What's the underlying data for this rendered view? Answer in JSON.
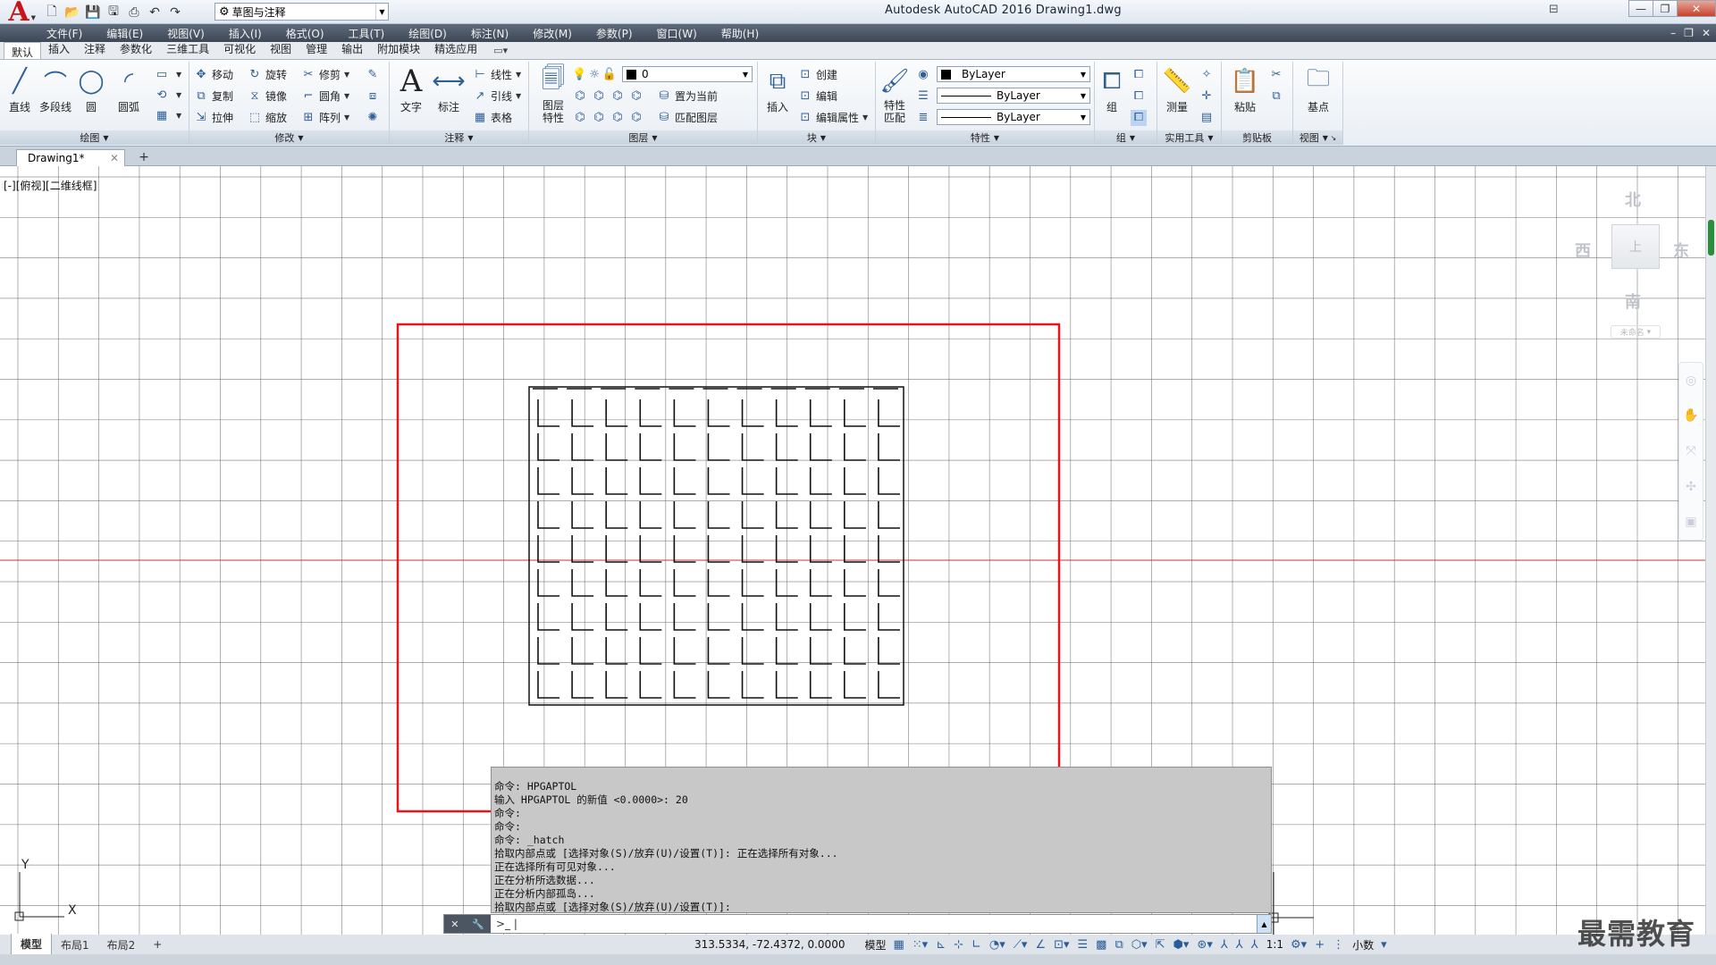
{
  "app": {
    "title": "Autodesk AutoCAD 2016    Drawing1.dwg",
    "workspace": "草图与注释",
    "logo_letter": "A"
  },
  "menu": [
    "文件(F)",
    "编辑(E)",
    "视图(V)",
    "插入(I)",
    "格式(O)",
    "工具(T)",
    "绘图(D)",
    "标注(N)",
    "修改(M)",
    "参数(P)",
    "窗口(W)",
    "帮助(H)"
  ],
  "ribbon_tabs": [
    "默认",
    "插入",
    "注释",
    "参数化",
    "三维工具",
    "可视化",
    "视图",
    "管理",
    "输出",
    "附加模块",
    "精选应用"
  ],
  "ribbon": {
    "draw": {
      "title": "绘图",
      "line": "直线",
      "polyline": "多段线",
      "circle": "圆",
      "arc": "圆弧"
    },
    "modify": {
      "title": "修改",
      "move": "移动",
      "rotate": "旋转",
      "trim": "修剪",
      "copy": "复制",
      "mirror": "镜像",
      "fillet": "圆角",
      "stretch": "拉伸",
      "scale": "缩放",
      "array": "阵列"
    },
    "annotation": {
      "title": "注释",
      "text": "文字",
      "dimension": "标注",
      "linear": "线性",
      "leader": "引线",
      "table": "表格"
    },
    "layers": {
      "title": "图层",
      "layer_props_1": "图层",
      "layer_props_2": "特性",
      "current_layer": "0",
      "set_current": "置为当前",
      "match_layer": "匹配图层"
    },
    "block": {
      "title": "块",
      "insert": "插入",
      "create": "创建",
      "edit": "编辑",
      "edit_attr": "编辑属性"
    },
    "properties": {
      "title": "特性",
      "match_1": "特性",
      "match_2": "匹配",
      "color": "ByLayer",
      "linetype": "ByLayer",
      "lineweight": "ByLayer"
    },
    "groups": {
      "title": "组",
      "group": "组"
    },
    "utilities": {
      "title": "实用工具",
      "measure": "测量"
    },
    "clipboard": {
      "title": "剪贴板",
      "paste": "粘贴"
    },
    "view": {
      "title": "视图",
      "base": "基点"
    }
  },
  "doc_tab": "Drawing1*",
  "viewport_label": "[-][俯视][二维线框]",
  "viewcube": {
    "north": "北",
    "south": "南",
    "east": "东",
    "west": "西",
    "wcs": "未命名"
  },
  "command_history": [
    "命令: HPGAPTOL",
    "输入 HPGAPTOL 的新值 <0.0000>: 20",
    "命令:",
    "命令:",
    "命令: _hatch",
    "拾取内部点或 [选择对象(S)/放弃(U)/设置(T)]: 正在选择所有对象...",
    "正在选择所有可见对象...",
    "正在分析所选数据...",
    "正在分析内部孤岛...",
    "拾取内部点或 [选择对象(S)/放弃(U)/设置(T)]:"
  ],
  "ucs": {
    "x": "X",
    "y": "Y"
  },
  "layout_tabs": [
    "模型",
    "布局1",
    "布局2"
  ],
  "status": {
    "coords": "313.5334, -72.4372, 0.0000",
    "model": "模型",
    "scale": "1:1",
    "units": "小数"
  },
  "watermark": "最需教育",
  "colors": {
    "highlight": "#e8141a",
    "axis_red": "#c0392b",
    "grid": "#555555",
    "cmd_bg": "#c8c8c8"
  }
}
